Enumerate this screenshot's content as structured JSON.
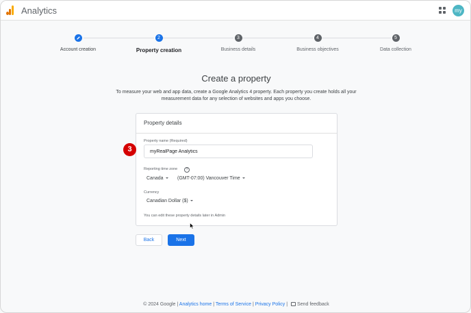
{
  "header": {
    "app_title": "Analytics",
    "avatar_text": "my"
  },
  "stepper": {
    "steps": [
      {
        "number": "",
        "label": "Account creation",
        "state": "done"
      },
      {
        "number": "2",
        "label": "Property creation",
        "state": "current"
      },
      {
        "number": "3",
        "label": "Business details",
        "state": "upcoming"
      },
      {
        "number": "4",
        "label": "Business objectives",
        "state": "upcoming"
      },
      {
        "number": "5",
        "label": "Data collection",
        "state": "upcoming"
      }
    ]
  },
  "main": {
    "title": "Create a property",
    "description": "To measure your web and app data, create a Google Analytics 4 property. Each property you create holds all your measurement data for any selection of websites and apps you choose."
  },
  "card": {
    "title": "Property details",
    "property_name_label": "Property name (Required)",
    "property_name_value": "myRealPage Analytics",
    "timezone_label": "Reporting time zone",
    "timezone_help": "?",
    "country": "Canada",
    "timezone": "(GMT-07:00) Vancouver Time",
    "currency_label": "Currency",
    "currency": "Canadian Dollar ($)",
    "note": "You can edit these property details later in Admin"
  },
  "annotation": {
    "step_badge": "3"
  },
  "buttons": {
    "back": "Back",
    "next": "Next"
  },
  "footer": {
    "copyright": "© 2024 Google |",
    "analytics_home": "Analytics home",
    "sep1": "|",
    "terms": "Terms of Service",
    "sep2": "|",
    "privacy": "Privacy Policy",
    "sep3": "|",
    "feedback": "Send feedback"
  },
  "colors": {
    "accent": "#1a73e8",
    "badge": "#d50000",
    "avatar": "#4db6c4"
  }
}
